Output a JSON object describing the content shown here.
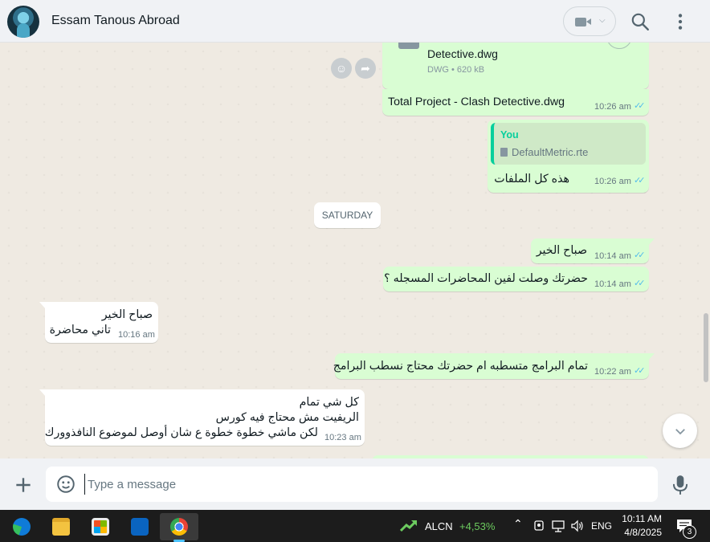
{
  "header": {
    "contact_name": "Essam Tanous Abroad"
  },
  "messages": {
    "file_name": "Detective.dwg",
    "file_meta": "DWG • 620 kB",
    "file_caption": "Total Project - Clash Detective.dwg",
    "file_time": "10:26 am",
    "quote_author": "You",
    "quote_file": "DefaultMetric.rte",
    "reply_text": "هذه كل الملفات",
    "reply_time": "10:26 am",
    "date_separator": "SATURDAY",
    "m1_text": "صباح الخير",
    "m1_time": "10:14 am",
    "m2_text": "حضرتك وصلت لفين المحاضرات المسجله ؟",
    "m2_time": "10:14 am",
    "m3_line1": "صباح الخير",
    "m3_line2": "تاني محاضرة",
    "m3_time": "10:16 am",
    "m4_text": "تمام البرامج متسطبه ام حضرتك محتاج نسطب البرامج",
    "m4_time": "10:22 am",
    "m5_line1": "كل شي تمام",
    "m5_line2": "الريفيت مش محتاج فيه كورس",
    "m5_line3": "لكن ماشي خطوة خطوة ع شان أوصل لموضوع النافذوورك",
    "m5_time": "10:23 am"
  },
  "composer": {
    "placeholder": "Type a message"
  },
  "taskbar": {
    "stock_symbol": "ALCN",
    "stock_change": "+4,53%",
    "language": "ENG",
    "time": "10:11 AM",
    "date": "4/8/2025",
    "notifications": "3"
  },
  "colors": {
    "outgoing_bubble": "#d9fdd3",
    "incoming_bubble": "#ffffff",
    "read_ticks": "#53bdeb",
    "quote_accent": "#06cf9c",
    "chat_background": "#efeae2"
  }
}
